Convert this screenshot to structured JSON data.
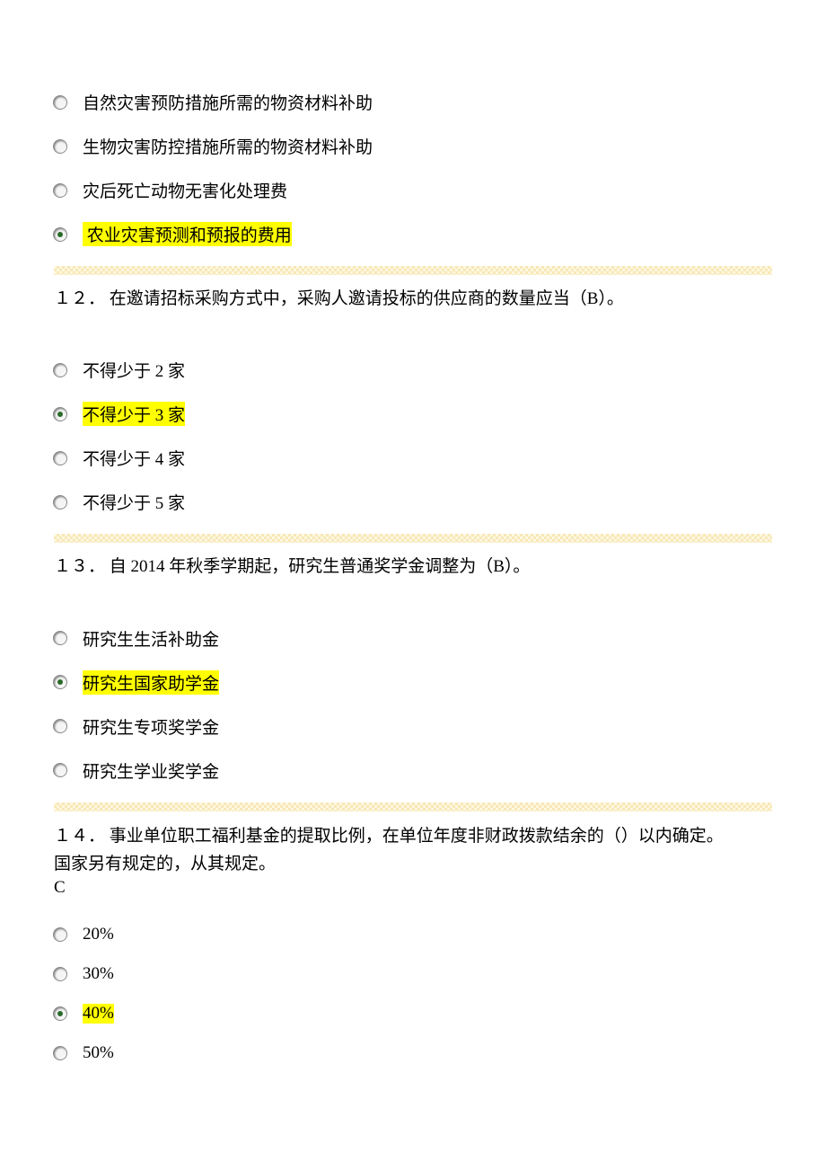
{
  "q11": {
    "options": [
      {
        "label": "自然灾害预防措施所需的物资材料补助",
        "selected": false,
        "highlight": false
      },
      {
        "label": "生物灾害防控措施所需的物资材料补助",
        "selected": false,
        "highlight": false
      },
      {
        "label": "灾后死亡动物无害化处理费",
        "selected": false,
        "highlight": false
      },
      {
        "label": " 农业灾害预测和预报的费用",
        "selected": true,
        "highlight": true
      }
    ]
  },
  "q12": {
    "text": "１２． 在邀请招标采购方式中，采购人邀请投标的供应商的数量应当（B）。",
    "options": [
      {
        "label": "不得少于 2 家",
        "selected": false,
        "highlight": false
      },
      {
        "label": "不得少于 3 家",
        "selected": true,
        "highlight": true
      },
      {
        "label": "不得少于 4 家",
        "selected": false,
        "highlight": false
      },
      {
        "label": "不得少于 5 家",
        "selected": false,
        "highlight": false
      }
    ]
  },
  "q13": {
    "text": "１３． 自 2014 年秋季学期起，研究生普通奖学金调整为（B）。",
    "options": [
      {
        "label": "研究生生活补助金",
        "selected": false,
        "highlight": false
      },
      {
        "label": "研究生国家助学金",
        "selected": true,
        "highlight": true
      },
      {
        "label": "研究生专项奖学金",
        "selected": false,
        "highlight": false
      },
      {
        "label": "研究生学业奖学金",
        "selected": false,
        "highlight": false
      }
    ]
  },
  "q14": {
    "text": "１４． 事业单位职工福利基金的提取比例，在单位年度非财政拨款结余的（）以内确定。",
    "line2": "国家另有规定的，从其规定。",
    "line3": "C",
    "options": [
      {
        "label": "20%",
        "selected": false,
        "highlight": false
      },
      {
        "label": "30%",
        "selected": false,
        "highlight": false
      },
      {
        "label": "40%",
        "selected": true,
        "highlight": true
      },
      {
        "label": "50%",
        "selected": false,
        "highlight": false
      }
    ]
  }
}
